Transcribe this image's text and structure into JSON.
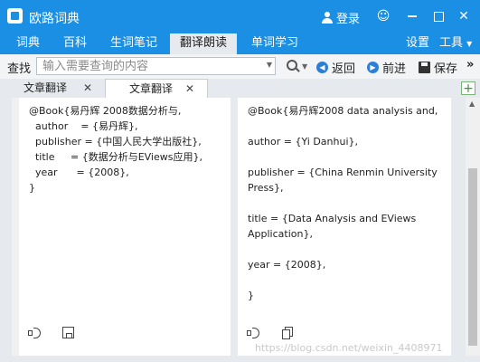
{
  "titlebar": {
    "title": "欧路词典",
    "login": "登录"
  },
  "menu": {
    "items": [
      "词典",
      "百科",
      "生词笔记",
      "翻译朗读",
      "单词学习"
    ],
    "right": [
      "设置",
      "工具"
    ],
    "active_index": 3
  },
  "toolbar": {
    "label": "查找",
    "search_placeholder": "输入需要查询的内容",
    "back": "返回",
    "forward": "前进",
    "save": "保存",
    "more": "»"
  },
  "tabs": [
    {
      "label": "文章翻译"
    },
    {
      "label": "文章翻译"
    }
  ],
  "left_pane": {
    "text": "@Book{易丹辉 2008数据分析与,\n  author    = {易丹辉},\n  publisher = {中国人民大学出版社},\n  title     = {数据分析与EViews应用},\n  year      = {2008},\n}"
  },
  "right_pane": {
    "lines": [
      "@Book{易丹辉2008 data analysis and,",
      "author = {Yi Danhui},",
      "publisher = {China Renmin University Press},",
      "title = {Data Analysis and EViews Application},",
      "year = {2008},",
      "}"
    ]
  },
  "watermark": "https://blog.csdn.net/weixin_4408971",
  "colors": {
    "titlebar": "#1a8fe3",
    "background": "#e6eaef"
  },
  "icons": [
    "user-icon",
    "smile-icon",
    "minimize-icon",
    "maximize-icon",
    "close-icon",
    "search-icon",
    "back-icon",
    "forward-icon",
    "save-icon",
    "add-tab-icon",
    "speaker-icon",
    "save-file-icon",
    "copy-icon"
  ]
}
